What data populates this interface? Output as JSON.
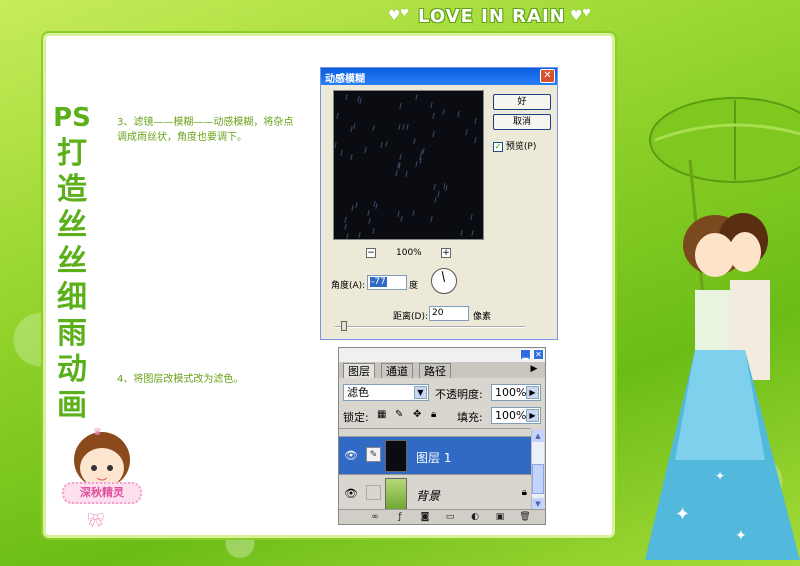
{
  "header": {
    "logo": "LOVE IN RAIN"
  },
  "vertical_title": [
    "PS",
    "打",
    "造",
    "丝",
    "丝",
    "细",
    "雨",
    "动",
    "画"
  ],
  "steps": {
    "step3": "3、滤镜——模糊——动感模糊，将杂点调成雨丝状，角度也要调下。",
    "step4": "4、将图层改模式改为滤色。"
  },
  "dialog": {
    "title": "动感模糊",
    "ok": "好",
    "cancel": "取消",
    "preview_label": "预览(P)",
    "preview_checked": true,
    "zoom": "100%",
    "zoom_minus": "−",
    "zoom_plus": "+",
    "angle_label": "角度(A):",
    "angle_value": "-77",
    "angle_unit": "度",
    "distance_label": "距离(D):",
    "distance_value": "20",
    "distance_unit": "像素",
    "slider_fraction": 0.04
  },
  "layers": {
    "tabs": [
      "图层",
      "通道",
      "路径"
    ],
    "blend_mode": "滤色",
    "opacity_label": "不透明度:",
    "opacity_value": "100%",
    "lock_label": "锁定:",
    "fill_label": "填充:",
    "fill_value": "100%",
    "items": [
      {
        "name": "图层 1",
        "selected": true
      },
      {
        "name": "背景",
        "selected": false,
        "locked": true
      }
    ]
  },
  "avatar_badge": "深秋精灵"
}
